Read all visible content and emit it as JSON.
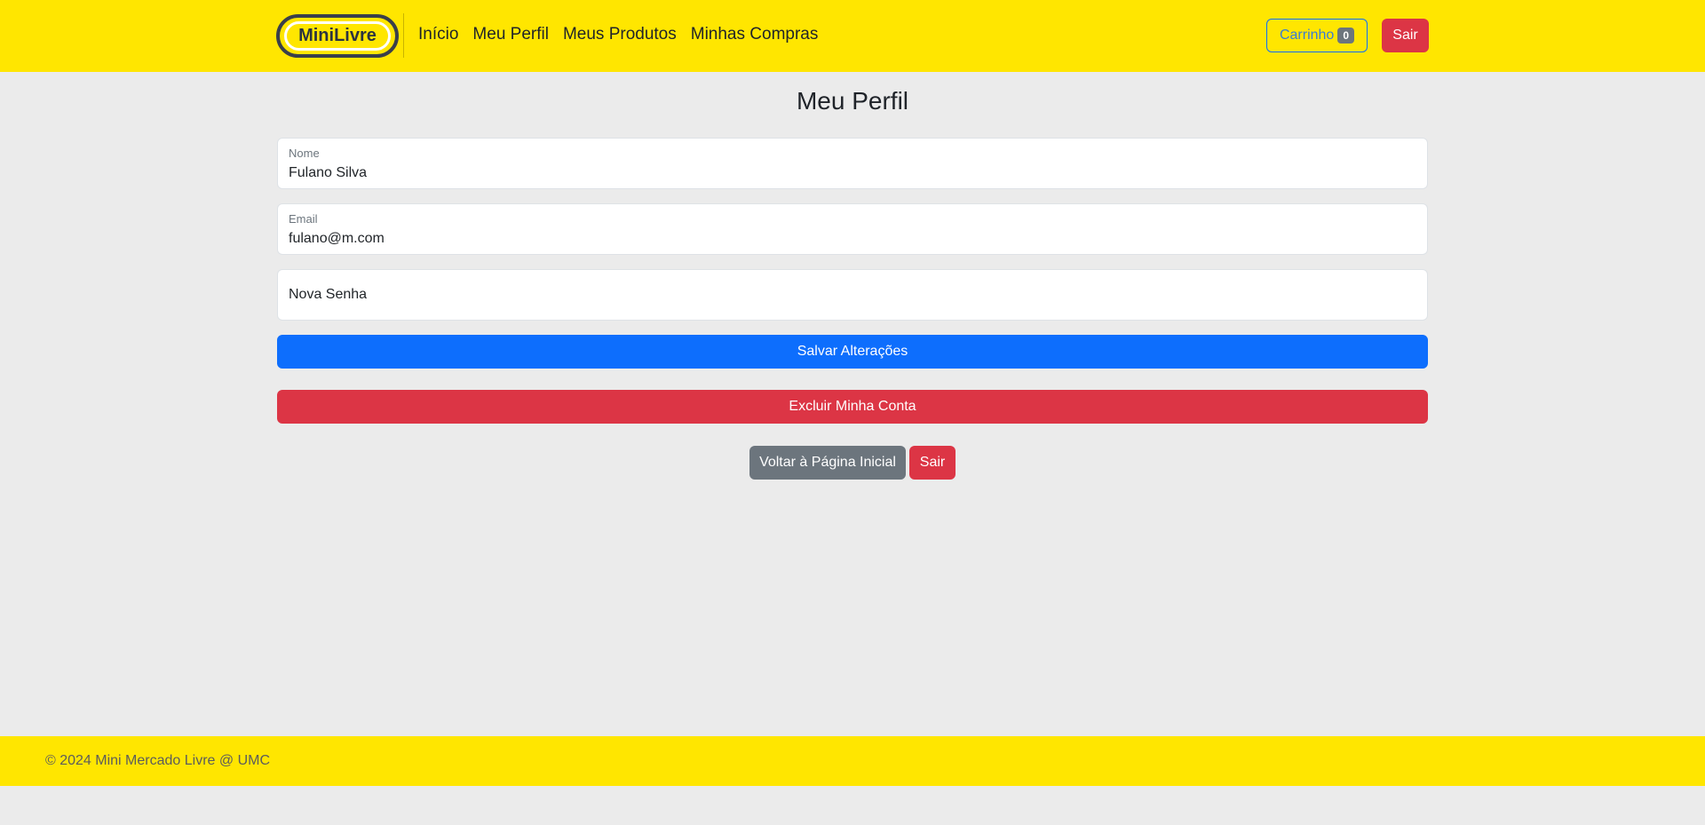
{
  "header": {
    "brand": "MiniLivre",
    "nav": [
      "Início",
      "Meu Perfil",
      "Meus Produtos",
      "Minhas Compras"
    ],
    "cart_label": "Carrinho",
    "cart_count": "0",
    "logout_label": "Sair"
  },
  "main": {
    "title": "Meu Perfil",
    "name_label": "Nome",
    "name_value": "Fulano Silva",
    "email_label": "Email",
    "email_value": "fulano@m.com",
    "password_placeholder": "Nova Senha",
    "save_label": "Salvar Alterações",
    "delete_label": "Excluir Minha Conta",
    "home_label": "Voltar à Página Inicial",
    "logout_label": "Sair"
  },
  "footer": {
    "text": "© 2024 Mini Mercado Livre @ UMC"
  },
  "colors": {
    "navbar_bg": "#ffe600",
    "primary": "#0d6efd",
    "danger": "#dc3545",
    "secondary": "#6c757d",
    "page_bg": "#ebebeb"
  }
}
